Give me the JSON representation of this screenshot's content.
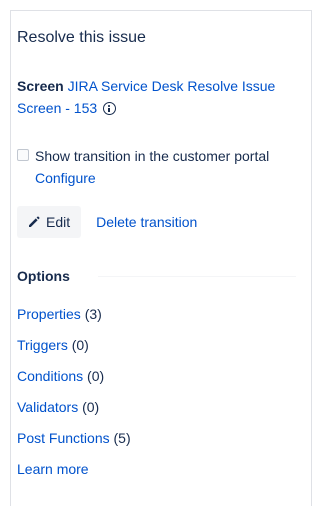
{
  "panel": {
    "title": "Resolve this issue",
    "screen": {
      "label": "Screen",
      "link_text": "JIRA Service Desk Resolve Issue Screen - 153",
      "info_icon": "info-icon"
    },
    "customer_portal": {
      "checked": false,
      "label": "Show transition in the customer portal",
      "configure_link": "Configure"
    },
    "actions": {
      "edit_label": "Edit",
      "edit_icon": "pencil-icon",
      "delete_label": "Delete transition"
    },
    "options": {
      "heading": "Options",
      "items": [
        {
          "label": "Properties",
          "count": "(3)"
        },
        {
          "label": "Triggers",
          "count": "(0)"
        },
        {
          "label": "Conditions",
          "count": "(0)"
        },
        {
          "label": "Validators",
          "count": "(0)"
        },
        {
          "label": "Post Functions",
          "count": "(5)"
        }
      ],
      "learn_more": "Learn more"
    }
  },
  "colors": {
    "link": "#0052cc",
    "text": "#172b4d",
    "button_bg": "#f4f5f7",
    "border": "#dfe1e6"
  }
}
